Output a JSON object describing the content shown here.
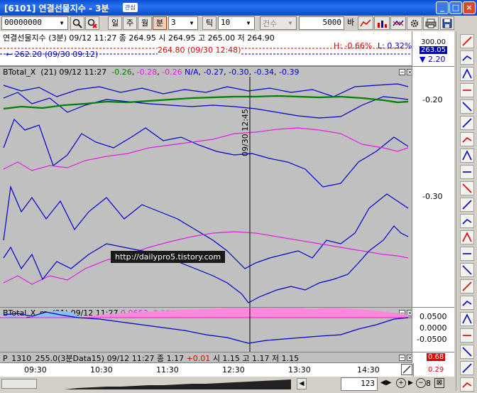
{
  "window": {
    "title": "[6101] 연결선물지수 - 3분",
    "tag": "관심",
    "buttons": [
      "_",
      "□",
      "×"
    ]
  },
  "toolbar": {
    "code_value": "00000000",
    "period_day": "일",
    "period_week": "주",
    "period_month": "월",
    "period_min": "분",
    "interval_value": "3",
    "tick_label": "틱",
    "tick_value": "10",
    "count_label": "건수",
    "count_value": "5000",
    "count_unit": "바"
  },
  "info": {
    "line1": "연결선물지수 (3분) 09/12 11:27  종 264.95  시 264.95  고 265.00  저 264.90",
    "low_label": "262.20 (09/30 09:12)",
    "high_label": "264.80 (09/30 12:48)",
    "h_pct": "H: -0.66%",
    "l_pct": "L: 0.32%",
    "scale_top": "300.00",
    "scale_price": "263.05",
    "scale_change": "▼ 2.20"
  },
  "panel1": {
    "name": "BTotal_X",
    "params": "(21) 09/12 11:27",
    "v1": "-0.26",
    "v2": "-0.28",
    "v3": "-0.26",
    "v4": "N/A",
    "v5": "-0.27",
    "v6": "-0.30",
    "v7": "-0.34",
    "v8": "-0.39",
    "cursor_time": "09/30 12:45",
    "ticks": [
      "-0.20",
      "-0.30"
    ]
  },
  "panel2": {
    "name": "BTotal_X_m",
    "params": "(21) 09/12 11:27",
    "v1": "0.0663",
    "v2": "0.0000",
    "ticks": [
      "0.0500",
      "0.0000",
      "-0.0500"
    ]
  },
  "panel3": {
    "text": "P_1310_255.0(3분Data15)  09/12 11:27  종 1.17",
    "chg": "+0.01",
    "rest": "시 1.15 고 1.17 저 1.15",
    "scale_v1": "0.68",
    "scale_v2": "0.29"
  },
  "time_axis": [
    "09:30",
    "10:30",
    "11:30",
    "12:30",
    "13:30",
    "14:30"
  ],
  "watermark": "http://dailypro5.tistory.com",
  "status": {
    "page_value": "123",
    "zoom_label": "8"
  },
  "colors": {
    "blue_series": "#0000c8",
    "magenta_series": "#e020e0",
    "green_series": "#008000",
    "fill_pink": "#ff88dd",
    "fill_blue": "#88c0f0",
    "red_text": "#e00000"
  }
}
